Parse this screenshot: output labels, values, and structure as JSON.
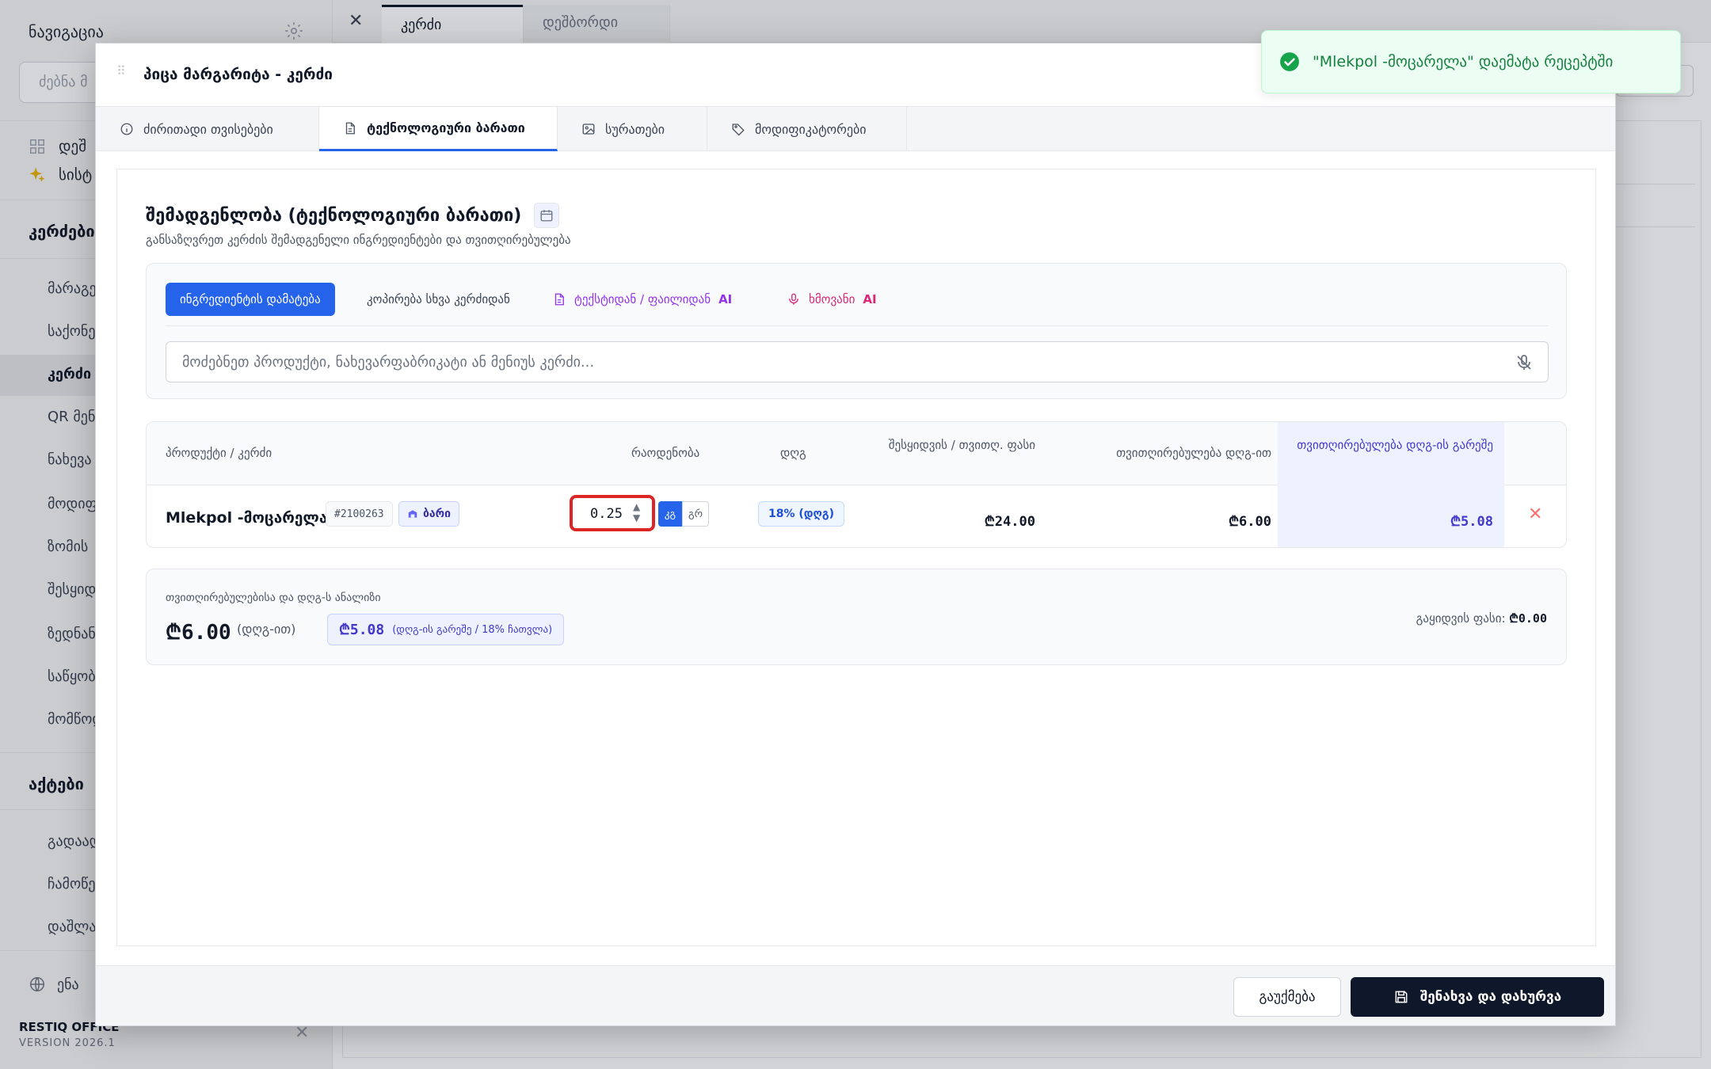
{
  "sidebar": {
    "title": "ნავიგაცია",
    "search_placeholder": "ძებნა მ",
    "quick": [
      {
        "label": "დეშ",
        "icon": "grid-icon"
      },
      {
        "label": "სისტ",
        "icon": "sparkles-icon"
      }
    ],
    "sections": [
      {
        "label": "კერძები",
        "items": [
          "მარაგე",
          "საქონე",
          "კერძი",
          "QR მენ",
          "ნახევა",
          "მოდიფ",
          "ზომის",
          "შესყიდ",
          "ზედნან",
          "საწყობ",
          "მომწოდ"
        ]
      },
      {
        "label": "აქტები",
        "items": [
          "გადაად",
          "ჩამოწე",
          "დაშლა"
        ]
      }
    ],
    "active_item": "კერძი",
    "language": "ენა",
    "brand": "RESTIQ OFFICE",
    "version": "VERSION 2026.1"
  },
  "main_tabs": [
    {
      "label": "კერძი",
      "active": true
    },
    {
      "label": "დეშბორდი",
      "active": false
    }
  ],
  "modal": {
    "title": "პიცა მარგარიტა - კერძი",
    "tabs": [
      {
        "label": "ძირითადი თვისებები",
        "icon": "info-icon"
      },
      {
        "label": "ტექნოლოგიური ბარათი",
        "icon": "document-icon"
      },
      {
        "label": "სურათები",
        "icon": "image-icon"
      },
      {
        "label": "მოდიფიკატორები",
        "icon": "tag-icon"
      }
    ],
    "active_tab": "ტექნოლოგიური ბარათი",
    "section_title": "შემადგენლობა (ტექნოლოგიური ბარათი)",
    "section_subtitle": "განსაზღვრეთ კერძის შემადგენელი ინგრედიენტები და თვითღირებულება",
    "add_panel": {
      "add_button": "ინგრედიენტის დამატება",
      "copy_link": "კოპირება სხვა კერძიდან",
      "text_ai_link": "ტექსტიდან / ფაილიდან",
      "voice_ai_link": "ხმოვანი",
      "ai_suffix": "AI",
      "search_placeholder": "მოძებნეთ პროდუქტი, ნახევარფაბრიკატი ან მენიუს კერძი..."
    },
    "table": {
      "headers": {
        "product": "პროდუქტი / კერძი",
        "quantity": "რაოდენობა",
        "vat": "დღგ",
        "purchase_price": "შესყიდვის / თვითღ. ფასი",
        "cost_with_vat": "თვითღირებულება დღგ-ით",
        "cost_without_vat": "თვითღირებულება დღგ-ის გარეშე"
      },
      "rows": [
        {
          "name": "Mlekpol -მოცარელა",
          "code": "#2100263",
          "stock": "ბარი",
          "quantity": "0.25",
          "unit_selected": "კგ",
          "unit_other": "გრ",
          "vat": "18% (დღგ)",
          "purchase_price": "₾24.00",
          "cost_with_vat": "₾6.00",
          "cost_without_vat": "₾5.08"
        }
      ]
    },
    "analysis": {
      "label": "თვითღირებულებისა და დღგ-ს ანალიზი",
      "total_with_vat": "₾6.00",
      "total_with_vat_note": "(დღგ-ით)",
      "total_without_vat": "₾5.08",
      "total_without_vat_note": "(დღგ-ის გარეშე / 18% ჩათვლა)",
      "sale_price_label": "გაყიდვის ფასი:",
      "sale_price": "₾0.00"
    },
    "footer": {
      "cancel": "გაუქმება",
      "save": "შენახვა და დახურვა"
    }
  },
  "toast": {
    "message": "\"Mlekpol -მოცარელა\" დაემატა რეცეპტში",
    "status_color": "#16a34a"
  },
  "colors": {
    "accent": "#2563eb",
    "highlight_text": "#4338ca",
    "danger": "#dc2626",
    "dark_button": "#0f172a"
  }
}
